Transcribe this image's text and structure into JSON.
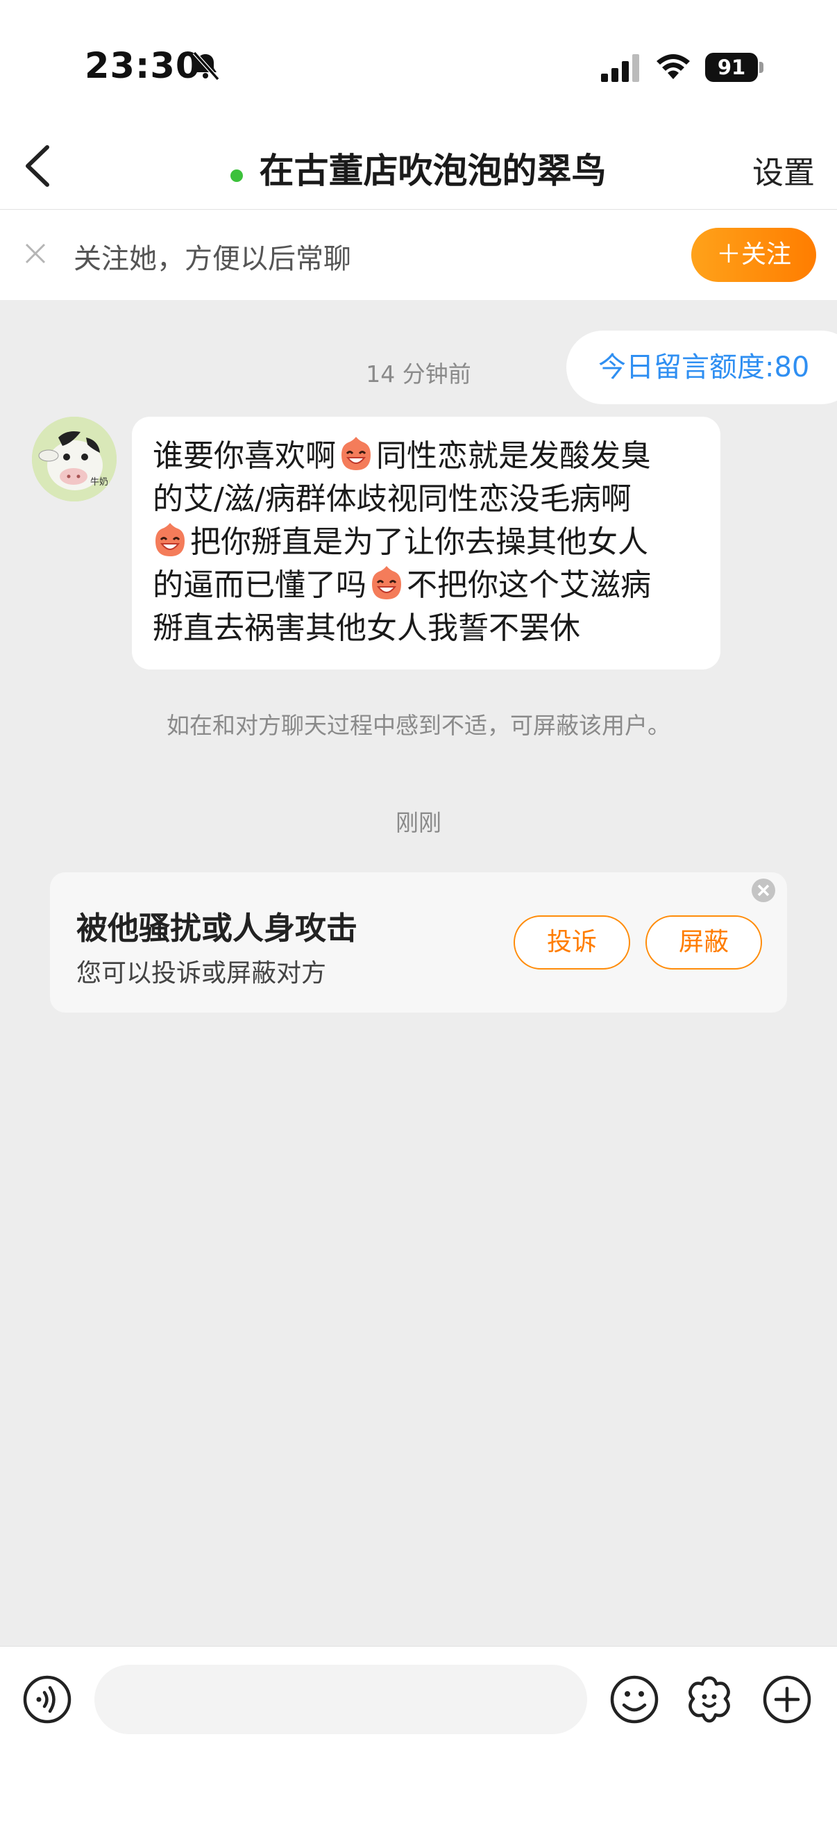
{
  "status_bar": {
    "time": "23:30",
    "battery": "91",
    "icons": [
      "bell-muted-icon",
      "signal-icon",
      "wifi-icon",
      "battery-icon"
    ]
  },
  "nav": {
    "back_icon": "chevron-left-icon",
    "title": "在古董店吹泡泡的翠鸟",
    "online": true,
    "settings_label": "设置"
  },
  "follow_bar": {
    "text": "关注她，方便以后常聊",
    "button_label": "＋关注",
    "close_icon": "close-icon"
  },
  "chat": {
    "quota_label": "今日留言额度:80",
    "timestamp_1": "14 分钟前",
    "message": {
      "lines": [
        [
          "谁要你喜欢啊",
          "同性恋就是发酸发臭"
        ],
        [
          "的艾/滋/病群体歧视同性恋没毛病啊"
        ],
        [
          "",
          "把你掰直是为了让你去操其他女人"
        ],
        [
          "的逼而已懂了吗",
          "不把你这个艾滋病"
        ],
        [
          "掰直去祸害其他女人我誓不罢休"
        ]
      ],
      "emoji": "laughing-face-emoji",
      "avatar_caption": "牛奶"
    },
    "notice": "如在和对方聊天过程中感到不适，可屏蔽该用户。",
    "timestamp_2": "刚刚"
  },
  "safety_card": {
    "title": "被他骚扰或人身攻击",
    "subtitle": "您可以投诉或屏蔽对方",
    "complain_label": "投诉",
    "block_label": "屏蔽"
  },
  "input_bar": {
    "placeholder": "",
    "icons": [
      "voice-icon",
      "emoji-icon",
      "sticker-icon",
      "add-icon"
    ]
  },
  "colors": {
    "accent": "#ff7d00",
    "link": "#2f8ff2",
    "online": "#3cc13b",
    "background": "#ededed"
  }
}
